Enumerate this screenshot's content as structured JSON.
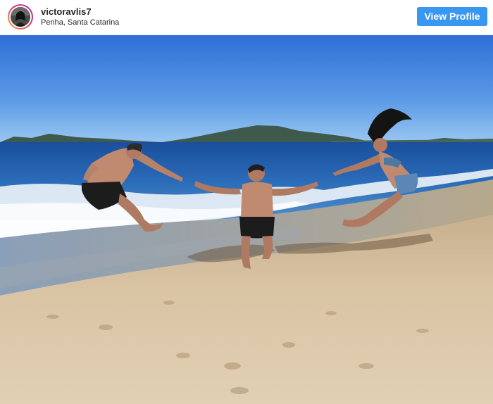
{
  "post": {
    "username": "victoravlis7",
    "location": "Penha, Santa Catarina",
    "view_profile_label": "View Profile"
  },
  "colors": {
    "button_bg": "#3897f0",
    "button_text": "#ffffff",
    "text": "#262626"
  },
  "icons": {
    "avatar": "profile-photo",
    "post_image": "beach-photo-three-people-jumping"
  }
}
